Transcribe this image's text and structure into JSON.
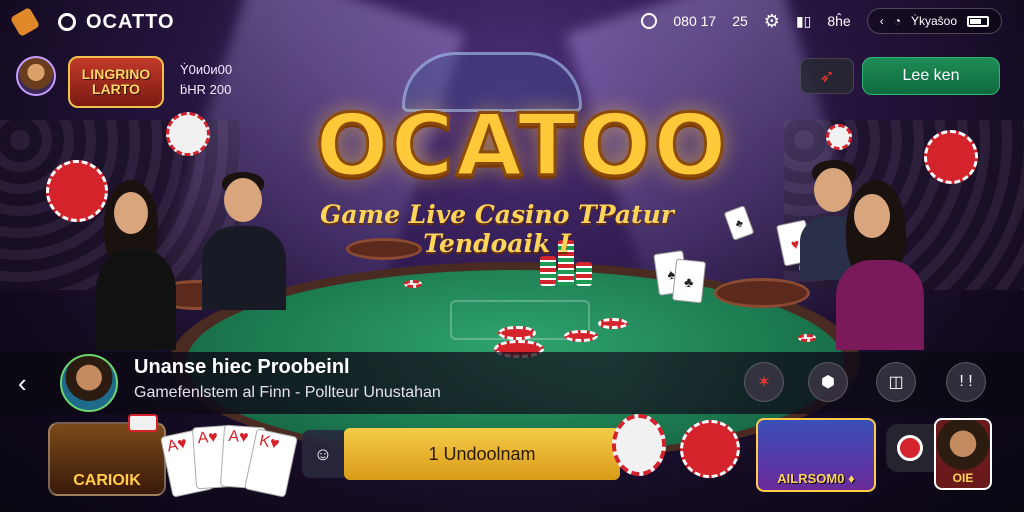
{
  "status_bar": {
    "app_title": "OCATTO",
    "time_text": "080 17",
    "signal_text": "25",
    "battery_label": "8ĥe",
    "pill_text": "Ẏkyaŝoo"
  },
  "profile": {
    "logo_line1": "LINGRINO",
    "logo_line2": "LARTO",
    "balance_line1": "Ẏ0ᴎ0ᴎ00",
    "balance_line2": "ḃHR 200"
  },
  "actions": {
    "login_label": "Lee ken"
  },
  "hero": {
    "title": "OCATOO",
    "subtitle": "Game Live Casino TPatur Tendoaik I"
  },
  "info": {
    "title": "Unanse hiec Proobeinl",
    "subtitle": "Gamefenlstem al Finn - Pollteur Unustahan"
  },
  "bottom": {
    "game_caption": "CARIOIK",
    "cta_label": "1 Undoolnam",
    "live_caption": "AILRSOM0 ♦",
    "dealer_caption": "OIE"
  },
  "colors": {
    "accent_gold": "#ffc93a",
    "login_green": "#1e8c56",
    "chip_red": "#d5232b",
    "table_green": "#1d7b50"
  }
}
